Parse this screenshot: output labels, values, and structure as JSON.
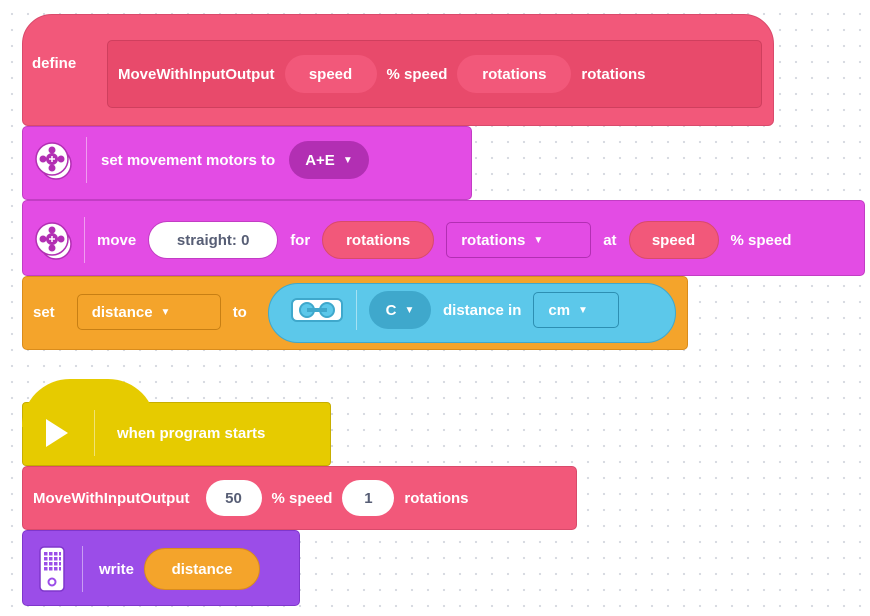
{
  "define_block": {
    "keyword": "define",
    "name": "MoveWithInputOutput",
    "param1": "speed",
    "text1": "% speed",
    "param2": "rotations",
    "text2": "rotations"
  },
  "set_motors_block": {
    "label": "set movement motors to",
    "ports": "A+E",
    "icon": "motor-pair-icon"
  },
  "move_block": {
    "label": "move",
    "direction": "straight: 0",
    "for_label": "for",
    "amount": "rotations",
    "unit": "rotations",
    "at_label": "at",
    "speed": "speed",
    "speed_text": "% speed",
    "icon": "motor-pair-icon"
  },
  "set_var_block": {
    "label": "set",
    "variable": "distance",
    "to_label": "to",
    "sensor_icon": "distance-sensor-icon",
    "port": "C",
    "sensor_label": "distance in",
    "unit": "cm"
  },
  "hat_block": {
    "label": "when program starts",
    "icon": "play-icon"
  },
  "call_block": {
    "name": "MoveWithInputOutput",
    "speed_value": "50",
    "speed_text": "% speed",
    "rotations_value": "1",
    "rotations_text": "rotations"
  },
  "write_block": {
    "label": "write",
    "value": "distance",
    "icon": "hub-display-icon"
  },
  "colors": {
    "define": "#f2587a",
    "define_inner": "#e84a6b",
    "motors": "#e34ce4",
    "motors_dark": "#b22fb3",
    "variables": "#f4a42b",
    "sensors": "#5cc8ea",
    "events": "#e6cb00",
    "display": "#9b4de8",
    "white": "#ffffff"
  }
}
